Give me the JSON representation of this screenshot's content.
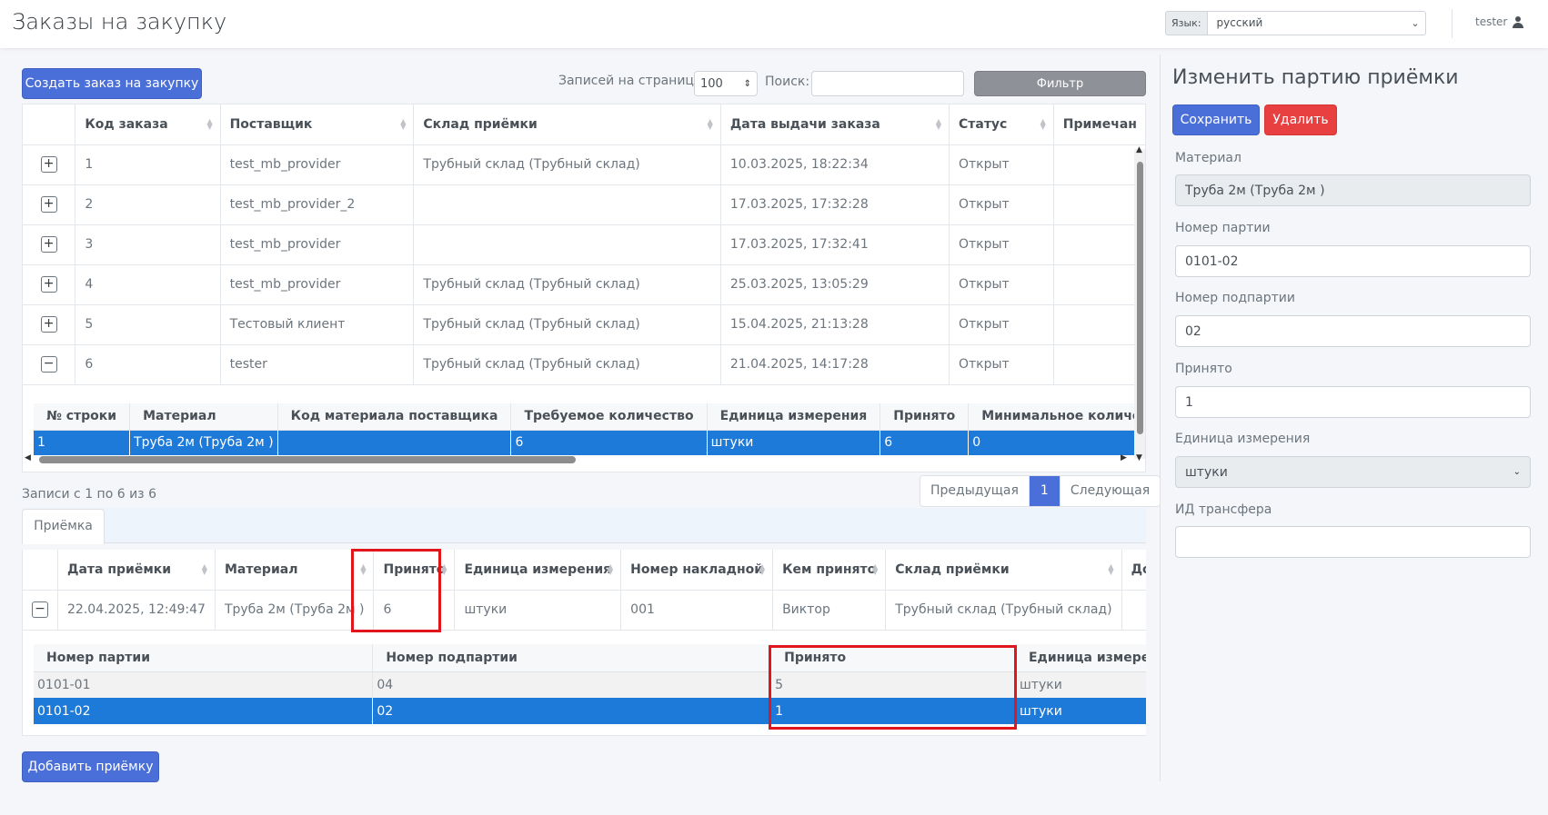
{
  "header": {
    "title": "Заказы на закупку",
    "lang_label": "Язык:",
    "lang_value": "русский",
    "user": "tester"
  },
  "toolbar": {
    "create_button": "Создать заказ на закупку",
    "per_page_label": "Записей на страницу:",
    "per_page_value": "100",
    "search_label": "Поиск:",
    "search_value": "",
    "filter_button": "Фильтр"
  },
  "orders": {
    "columns": [
      "Код заказа",
      "Поставщик",
      "Склад приёмки",
      "Дата выдачи заказа",
      "Статус",
      "Примечан"
    ],
    "rows": [
      {
        "toggle": "+",
        "id": "1",
        "supplier": "test_mb_provider",
        "warehouse": "Трубный склад (Трубный склад)",
        "date": "10.03.2025, 18:22:34",
        "status": "Открыт"
      },
      {
        "toggle": "+",
        "id": "2",
        "supplier": "test_mb_provider_2",
        "warehouse": "",
        "date": "17.03.2025, 17:32:28",
        "status": "Открыт"
      },
      {
        "toggle": "+",
        "id": "3",
        "supplier": "test_mb_provider",
        "warehouse": "",
        "date": "17.03.2025, 17:32:41",
        "status": "Открыт"
      },
      {
        "toggle": "+",
        "id": "4",
        "supplier": "test_mb_provider",
        "warehouse": "Трубный склад (Трубный склад)",
        "date": "25.03.2025, 13:05:29",
        "status": "Открыт"
      },
      {
        "toggle": "+",
        "id": "5",
        "supplier": "Тестовый клиент",
        "warehouse": "Трубный склад (Трубный склад)",
        "date": "15.04.2025, 21:13:28",
        "status": "Открыт"
      },
      {
        "toggle": "−",
        "id": "6",
        "supplier": "tester",
        "warehouse": "Трубный склад (Трубный склад)",
        "date": "21.04.2025, 14:17:28",
        "status": "Открыт"
      }
    ],
    "sub_columns": [
      "№ строки",
      "Материал",
      "Код материала поставщика",
      "Требуемое количество",
      "Единица измерения",
      "Принято",
      "Минимальное количество"
    ],
    "sub_rows": [
      [
        "1",
        "Труба 2м (Труба 2м )",
        "",
        "6",
        "штуки",
        "6",
        "0"
      ]
    ]
  },
  "pagination": {
    "info": "Записи с 1 по 6 из 6",
    "prev": "Предыдущая",
    "page": "1",
    "next": "Следующая"
  },
  "receipts": {
    "tab": "Приёмка",
    "columns": [
      "Дата приёмки",
      "Материал",
      "Принято",
      "Единица измерения",
      "Номер накладной",
      "Кем принято",
      "Склад приёмки",
      "Дополни"
    ],
    "row": {
      "toggle": "−",
      "date": "22.04.2025, 12:49:47",
      "material": "Труба 2м (Труба 2м )",
      "accepted": "6",
      "unit": "штуки",
      "invoice": "001",
      "by": "Виктор",
      "warehouse": "Трубный склад (Трубный склад)"
    },
    "sub_columns": [
      "Номер партии",
      "Номер подпартии",
      "Принято",
      "Единица измерен"
    ],
    "sub_rows": [
      [
        "0101-01",
        "04",
        "5",
        "штуки"
      ],
      [
        "0101-02",
        "02",
        "1",
        "штуки"
      ]
    ],
    "add_button": "Добавить приёмку"
  },
  "edit_panel": {
    "title": "Изменить партию приёмки",
    "save": "Сохранить",
    "delete": "Удалить",
    "material_label": "Материал",
    "material_value": "Труба 2м (Труба 2м )",
    "batch_label": "Номер партии",
    "batch_value": "0101-02",
    "subbatch_label": "Номер подпартии",
    "subbatch_value": "02",
    "accepted_label": "Принято",
    "accepted_value": "1",
    "unit_label": "Единица измерения",
    "unit_value": "штуки",
    "transfer_label": "ИД трансфера",
    "transfer_value": ""
  },
  "colors": {
    "primary": "#4b6fd8",
    "danger": "#e84040",
    "selected_row": "#1e7ad8",
    "highlight_box": "#e0161c"
  }
}
